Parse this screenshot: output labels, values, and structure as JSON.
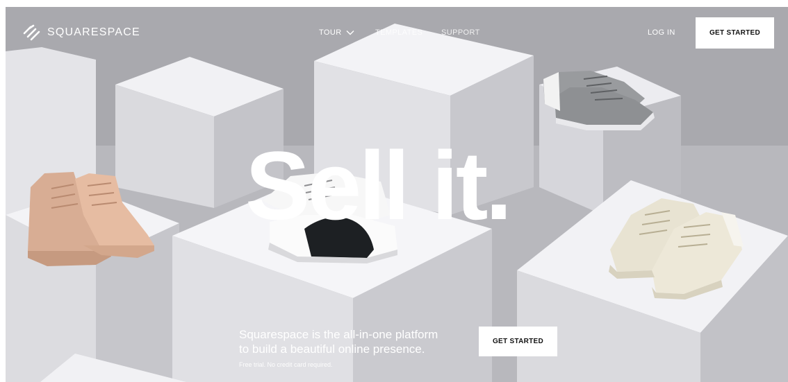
{
  "brand": {
    "logo_icon": "squarespace-logo-icon",
    "name": "SQUARESPACE"
  },
  "nav": {
    "tour": "TOUR",
    "tour_icon": "chevron-down-icon",
    "templates": "TEMPLATES",
    "support": "SUPPORT",
    "login": "LOG IN",
    "get_started": "GET STARTED"
  },
  "hero": {
    "headline": "Sell it.",
    "pitch_line_1": "Squarespace is the all-in-one platform",
    "pitch_line_2": "to build a beautiful online presence.",
    "fine_print": "Free trial. No credit card required.",
    "cta": "GET STARTED"
  },
  "colors": {
    "background": "#b9b9be",
    "text": "#ffffff",
    "button_bg": "#ffffff",
    "button_text": "#111111"
  }
}
